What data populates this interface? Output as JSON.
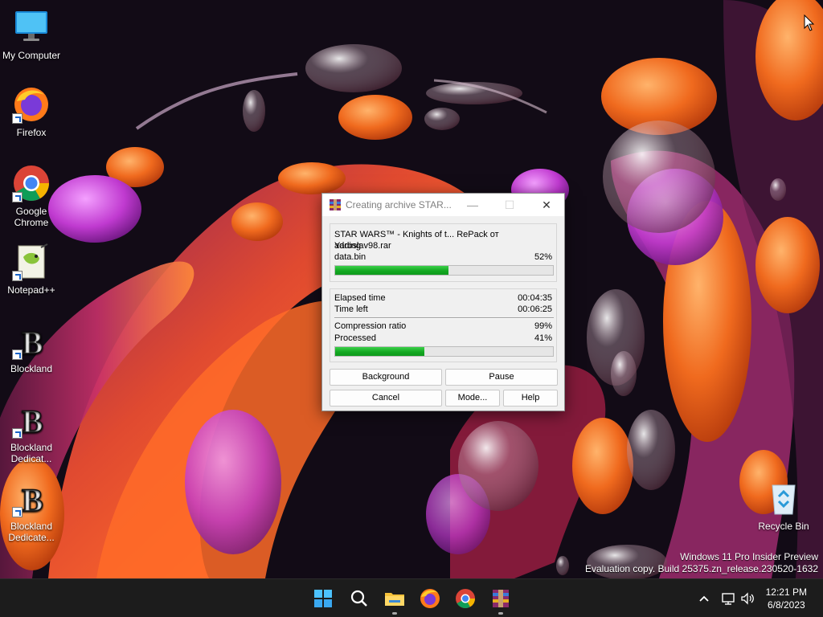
{
  "desktop": {
    "icons": [
      {
        "label": "My Computer",
        "icon": "monitor-icon"
      },
      {
        "label": "Firefox",
        "icon": "firefox-icon"
      },
      {
        "label": "Google Chrome",
        "icon": "chrome-icon"
      },
      {
        "label": "Notepad++",
        "icon": "notepadpp-icon"
      },
      {
        "label": "Blockland",
        "icon": "blockland-icon"
      },
      {
        "label": "Blockland Dedicat...",
        "icon": "blockland-icon"
      },
      {
        "label": "Blockland Dedicate...",
        "icon": "blockland-icon"
      },
      {
        "label": "Recycle Bin",
        "icon": "recycle-bin-icon"
      }
    ],
    "watermark": {
      "line1": "Windows 11 Pro Insider Preview",
      "line2": "Evaluation copy. Build 25375.zn_release.230520-1632"
    }
  },
  "dialog": {
    "title": "Creating archive STAR...",
    "archive_name": "STAR WARS™ - Knights of t... RePack от Yaroslav98.rar",
    "action": "adding",
    "current_file": "data.bin",
    "file_percent": "52%",
    "file_progress": 0.52,
    "elapsed_label": "Elapsed time",
    "elapsed_value": "00:04:35",
    "timeleft_label": "Time left",
    "timeleft_value": "00:06:25",
    "ratio_label": "Compression ratio",
    "ratio_value": "99%",
    "processed_label": "Processed",
    "processed_value": "41%",
    "processed_progress": 0.41,
    "buttons": {
      "background": "Background",
      "pause": "Pause",
      "cancel": "Cancel",
      "mode": "Mode...",
      "help": "Help"
    }
  },
  "taskbar": {
    "time": "12:21 PM",
    "date": "6/8/2023"
  },
  "colors": {
    "progress_green": "#14a822",
    "taskbar_bg": "#1c1c1c"
  }
}
